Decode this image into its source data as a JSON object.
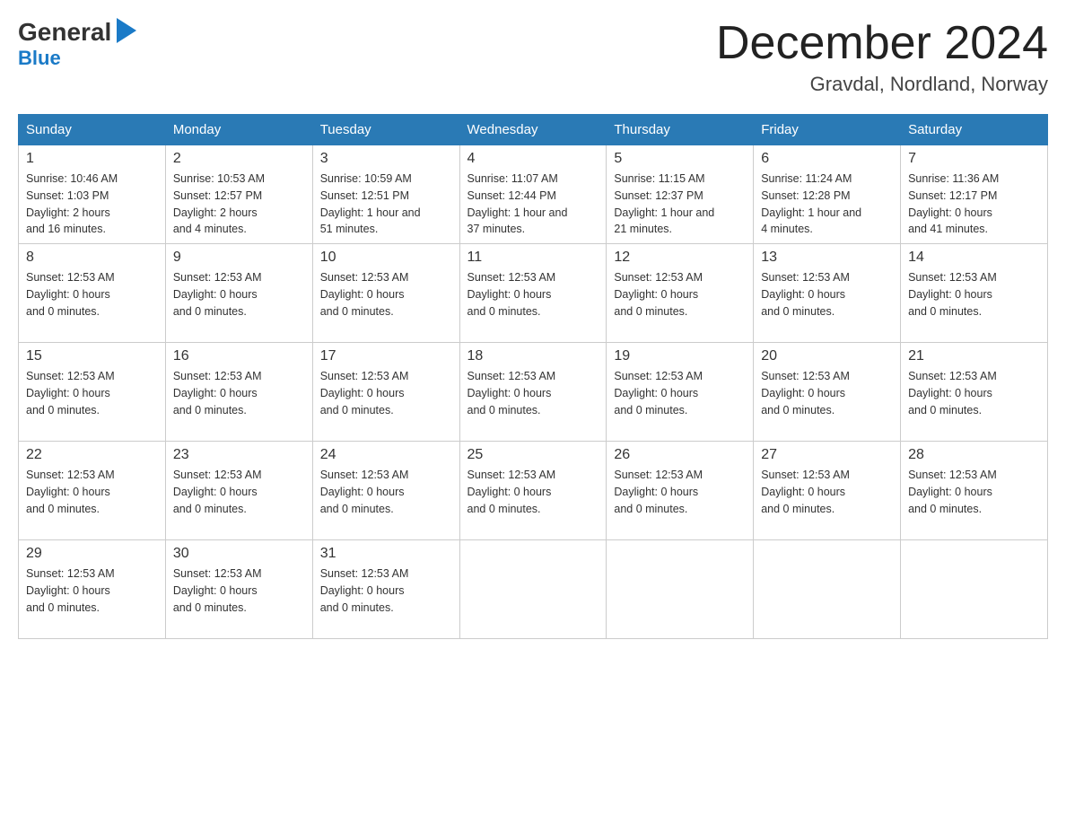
{
  "logo": {
    "general": "General",
    "blue": "Blue"
  },
  "header": {
    "title": "December 2024",
    "location": "Gravdal, Nordland, Norway"
  },
  "weekdays": [
    "Sunday",
    "Monday",
    "Tuesday",
    "Wednesday",
    "Thursday",
    "Friday",
    "Saturday"
  ],
  "weeks": [
    [
      {
        "day": "1",
        "info": "Sunrise: 10:46 AM\nSunset: 1:03 PM\nDaylight: 2 hours\nand 16 minutes."
      },
      {
        "day": "2",
        "info": "Sunrise: 10:53 AM\nSunset: 12:57 PM\nDaylight: 2 hours\nand 4 minutes."
      },
      {
        "day": "3",
        "info": "Sunrise: 10:59 AM\nSunset: 12:51 PM\nDaylight: 1 hour and\n51 minutes."
      },
      {
        "day": "4",
        "info": "Sunrise: 11:07 AM\nSunset: 12:44 PM\nDaylight: 1 hour and\n37 minutes."
      },
      {
        "day": "5",
        "info": "Sunrise: 11:15 AM\nSunset: 12:37 PM\nDaylight: 1 hour and\n21 minutes."
      },
      {
        "day": "6",
        "info": "Sunrise: 11:24 AM\nSunset: 12:28 PM\nDaylight: 1 hour and\n4 minutes."
      },
      {
        "day": "7",
        "info": "Sunrise: 11:36 AM\nSunset: 12:17 PM\nDaylight: 0 hours\nand 41 minutes."
      }
    ],
    [
      {
        "day": "8",
        "info": "Sunset: 12:53 AM\nDaylight: 0 hours\nand 0 minutes."
      },
      {
        "day": "9",
        "info": "Sunset: 12:53 AM\nDaylight: 0 hours\nand 0 minutes."
      },
      {
        "day": "10",
        "info": "Sunset: 12:53 AM\nDaylight: 0 hours\nand 0 minutes."
      },
      {
        "day": "11",
        "info": "Sunset: 12:53 AM\nDaylight: 0 hours\nand 0 minutes."
      },
      {
        "day": "12",
        "info": "Sunset: 12:53 AM\nDaylight: 0 hours\nand 0 minutes."
      },
      {
        "day": "13",
        "info": "Sunset: 12:53 AM\nDaylight: 0 hours\nand 0 minutes."
      },
      {
        "day": "14",
        "info": "Sunset: 12:53 AM\nDaylight: 0 hours\nand 0 minutes."
      }
    ],
    [
      {
        "day": "15",
        "info": "Sunset: 12:53 AM\nDaylight: 0 hours\nand 0 minutes."
      },
      {
        "day": "16",
        "info": "Sunset: 12:53 AM\nDaylight: 0 hours\nand 0 minutes."
      },
      {
        "day": "17",
        "info": "Sunset: 12:53 AM\nDaylight: 0 hours\nand 0 minutes."
      },
      {
        "day": "18",
        "info": "Sunset: 12:53 AM\nDaylight: 0 hours\nand 0 minutes."
      },
      {
        "day": "19",
        "info": "Sunset: 12:53 AM\nDaylight: 0 hours\nand 0 minutes."
      },
      {
        "day": "20",
        "info": "Sunset: 12:53 AM\nDaylight: 0 hours\nand 0 minutes."
      },
      {
        "day": "21",
        "info": "Sunset: 12:53 AM\nDaylight: 0 hours\nand 0 minutes."
      }
    ],
    [
      {
        "day": "22",
        "info": "Sunset: 12:53 AM\nDaylight: 0 hours\nand 0 minutes."
      },
      {
        "day": "23",
        "info": "Sunset: 12:53 AM\nDaylight: 0 hours\nand 0 minutes."
      },
      {
        "day": "24",
        "info": "Sunset: 12:53 AM\nDaylight: 0 hours\nand 0 minutes."
      },
      {
        "day": "25",
        "info": "Sunset: 12:53 AM\nDaylight: 0 hours\nand 0 minutes."
      },
      {
        "day": "26",
        "info": "Sunset: 12:53 AM\nDaylight: 0 hours\nand 0 minutes."
      },
      {
        "day": "27",
        "info": "Sunset: 12:53 AM\nDaylight: 0 hours\nand 0 minutes."
      },
      {
        "day": "28",
        "info": "Sunset: 12:53 AM\nDaylight: 0 hours\nand 0 minutes."
      }
    ],
    [
      {
        "day": "29",
        "info": "Sunset: 12:53 AM\nDaylight: 0 hours\nand 0 minutes."
      },
      {
        "day": "30",
        "info": "Sunset: 12:53 AM\nDaylight: 0 hours\nand 0 minutes."
      },
      {
        "day": "31",
        "info": "Sunset: 12:53 AM\nDaylight: 0 hours\nand 0 minutes."
      },
      {
        "day": "",
        "info": ""
      },
      {
        "day": "",
        "info": ""
      },
      {
        "day": "",
        "info": ""
      },
      {
        "day": "",
        "info": ""
      }
    ]
  ]
}
